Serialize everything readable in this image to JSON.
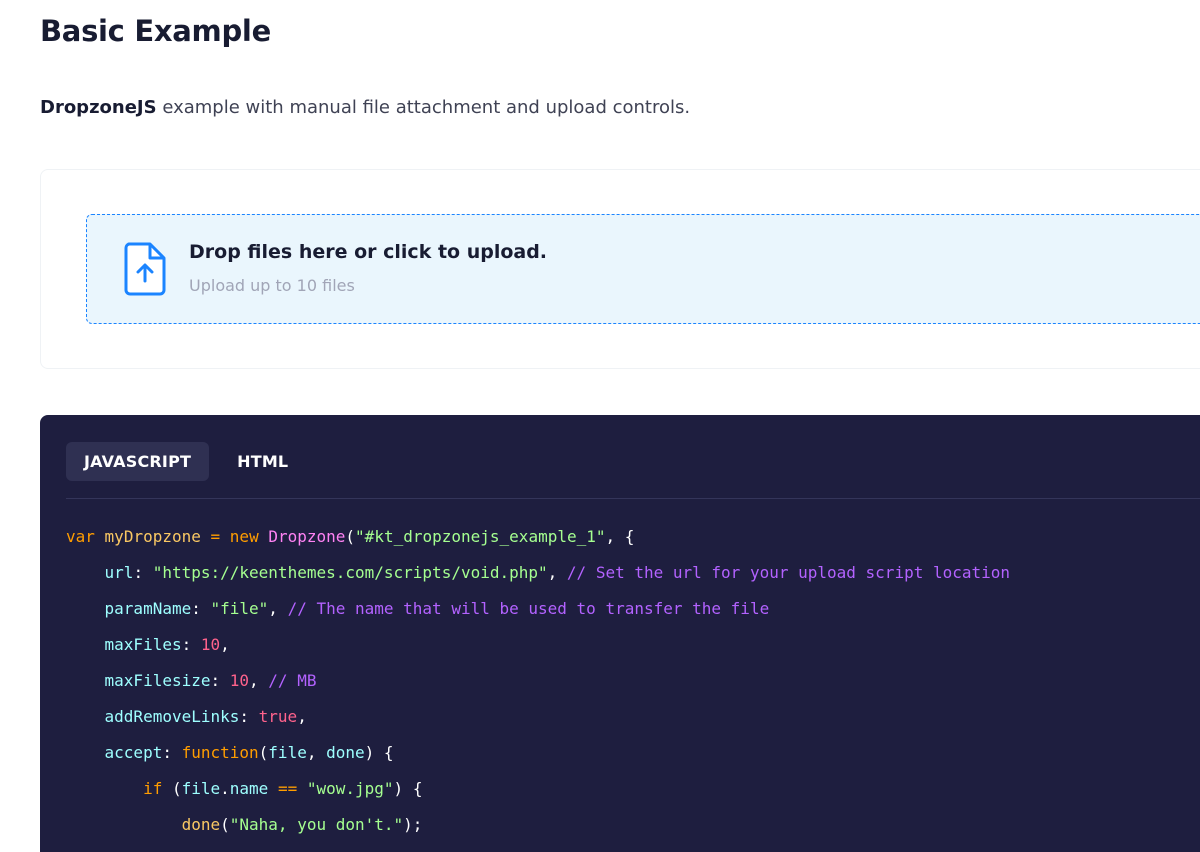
{
  "header": {
    "title": "Basic Example"
  },
  "description": {
    "strong": "DropzoneJS",
    "rest": " example with manual file attachment and upload controls."
  },
  "dropzone": {
    "title": "Drop files here or click to upload.",
    "subtitle": "Upload up to 10 files",
    "icon": "file-upload-icon",
    "accent_color": "#1b84ff",
    "background_color": "#eaf6fd"
  },
  "code_block": {
    "tabs": [
      {
        "label": "JAVASCRIPT",
        "active": true
      },
      {
        "label": "HTML",
        "active": false
      }
    ],
    "background_color": "#1e1e3f",
    "lines": [
      [
        {
          "t": "var",
          "c": "kw"
        },
        {
          "t": " ",
          "c": "plain"
        },
        {
          "t": "myDropzone",
          "c": "var"
        },
        {
          "t": " ",
          "c": "plain"
        },
        {
          "t": "=",
          "c": "op"
        },
        {
          "t": " ",
          "c": "plain"
        },
        {
          "t": "new",
          "c": "kw"
        },
        {
          "t": " ",
          "c": "plain"
        },
        {
          "t": "Dropzone",
          "c": "fn"
        },
        {
          "t": "(",
          "c": "plain"
        },
        {
          "t": "\"#kt_dropzonejs_example_1\"",
          "c": "str"
        },
        {
          "t": ", {",
          "c": "plain"
        }
      ],
      [
        {
          "t": "    ",
          "c": "plain"
        },
        {
          "t": "url",
          "c": "prop"
        },
        {
          "t": ": ",
          "c": "plain"
        },
        {
          "t": "\"https://keenthemes.com/scripts/void.php\"",
          "c": "str"
        },
        {
          "t": ", ",
          "c": "plain"
        },
        {
          "t": "// Set the url for your upload script location",
          "c": "cmt"
        }
      ],
      [
        {
          "t": "    ",
          "c": "plain"
        },
        {
          "t": "paramName",
          "c": "prop"
        },
        {
          "t": ": ",
          "c": "plain"
        },
        {
          "t": "\"file\"",
          "c": "str"
        },
        {
          "t": ", ",
          "c": "plain"
        },
        {
          "t": "// The name that will be used to transfer the file",
          "c": "cmt"
        }
      ],
      [
        {
          "t": "    ",
          "c": "plain"
        },
        {
          "t": "maxFiles",
          "c": "prop"
        },
        {
          "t": ": ",
          "c": "plain"
        },
        {
          "t": "10",
          "c": "num"
        },
        {
          "t": ",",
          "c": "plain"
        }
      ],
      [
        {
          "t": "    ",
          "c": "plain"
        },
        {
          "t": "maxFilesize",
          "c": "prop"
        },
        {
          "t": ": ",
          "c": "plain"
        },
        {
          "t": "10",
          "c": "num"
        },
        {
          "t": ", ",
          "c": "plain"
        },
        {
          "t": "// MB",
          "c": "cmt"
        }
      ],
      [
        {
          "t": "    ",
          "c": "plain"
        },
        {
          "t": "addRemoveLinks",
          "c": "prop"
        },
        {
          "t": ": ",
          "c": "plain"
        },
        {
          "t": "true",
          "c": "num"
        },
        {
          "t": ",",
          "c": "plain"
        }
      ],
      [
        {
          "t": "    ",
          "c": "plain"
        },
        {
          "t": "accept",
          "c": "prop"
        },
        {
          "t": ": ",
          "c": "plain"
        },
        {
          "t": "function",
          "c": "kw"
        },
        {
          "t": "(",
          "c": "plain"
        },
        {
          "t": "file",
          "c": "prop"
        },
        {
          "t": ", ",
          "c": "plain"
        },
        {
          "t": "done",
          "c": "prop"
        },
        {
          "t": ") {",
          "c": "plain"
        }
      ],
      [
        {
          "t": "        ",
          "c": "plain"
        },
        {
          "t": "if",
          "c": "kw"
        },
        {
          "t": " (",
          "c": "plain"
        },
        {
          "t": "file",
          "c": "prop"
        },
        {
          "t": ".",
          "c": "plain"
        },
        {
          "t": "name",
          "c": "prop"
        },
        {
          "t": " ",
          "c": "plain"
        },
        {
          "t": "==",
          "c": "op"
        },
        {
          "t": " ",
          "c": "plain"
        },
        {
          "t": "\"wow.jpg\"",
          "c": "str"
        },
        {
          "t": ") {",
          "c": "plain"
        }
      ],
      [
        {
          "t": "            ",
          "c": "plain"
        },
        {
          "t": "done",
          "c": "var"
        },
        {
          "t": "(",
          "c": "plain"
        },
        {
          "t": "\"Naha, you don't.\"",
          "c": "str"
        },
        {
          "t": ");",
          "c": "plain"
        }
      ]
    ]
  }
}
